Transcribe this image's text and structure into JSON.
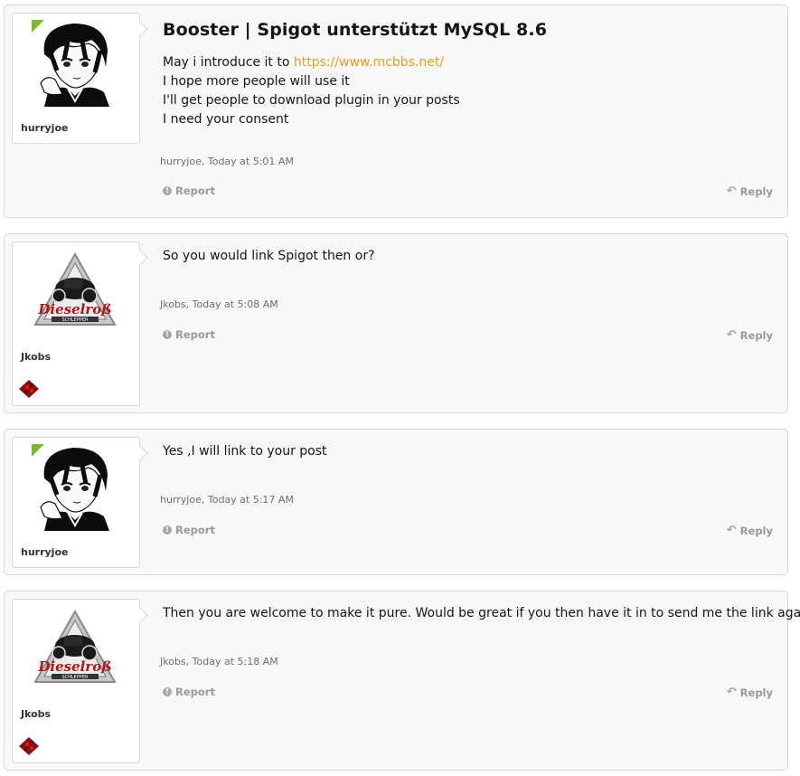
{
  "thread": {
    "title": "Booster | Spigot unterstützt MySQL 8.6"
  },
  "actions": {
    "report_label": "Report",
    "reply_label": "Reply"
  },
  "posts": [
    {
      "author": "hurryjoe",
      "avatar": "anime-boy-avatar",
      "online": true,
      "message_intro": "May i introduce it to ",
      "message_link": "https://www.mcbbs.net/",
      "message_lines": [
        "I hope more people will use it",
        "I'll get people to download plugin in your posts",
        "I need your consent"
      ],
      "meta_author": "hurryjoe",
      "meta_sep": ", ",
      "meta_time": "Today at 5:01 AM"
    },
    {
      "author": "Jkobs",
      "avatar": "dieselross-logo-avatar",
      "avatar_text": "Dieselroß",
      "avatar_subtext": "SCHLEPPER",
      "badge": "redstone-icon",
      "message": "So you would link Spigot then or?",
      "meta_author": "Jkobs",
      "meta_sep": ", ",
      "meta_time": "Today at 5:08 AM"
    },
    {
      "author": "hurryjoe",
      "avatar": "anime-boy-avatar",
      "online": true,
      "message": "Yes ,I will link to your post",
      "meta_author": "hurryjoe",
      "meta_sep": ", ",
      "meta_time": "Today at 5:17 AM"
    },
    {
      "author": "Jkobs",
      "avatar": "dieselross-logo-avatar",
      "avatar_text": "Dieselroß",
      "avatar_subtext": "SCHLEPPER",
      "badge": "redstone-icon",
      "message": "Then you are welcome to make it pure. Would be great if you then have it in to send me the link again.",
      "meta_author": "Jkobs",
      "meta_sep": ", ",
      "meta_time": "Today at 5:18 AM"
    }
  ],
  "colors": {
    "link": "#e6a020",
    "online": "#7dbb2d",
    "badge": "#a01010"
  }
}
